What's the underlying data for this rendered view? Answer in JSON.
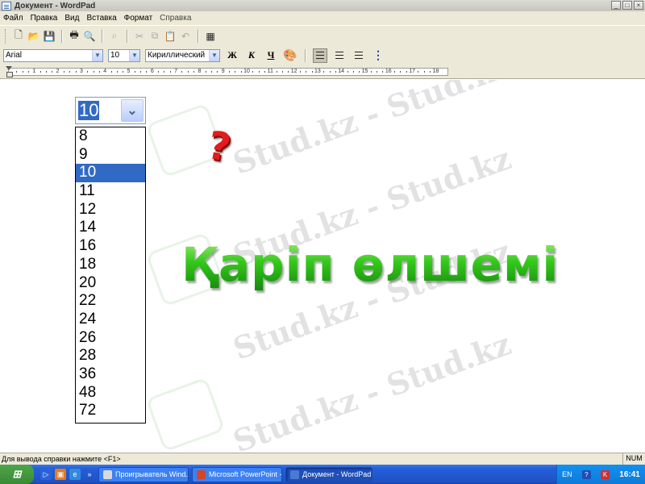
{
  "window": {
    "title": "Документ - WordPad",
    "min": "_",
    "max": "□",
    "close": "×"
  },
  "menu": [
    "Файл",
    "Правка",
    "Вид",
    "Вставка",
    "Формат",
    "Справка"
  ],
  "format": {
    "font": "Arial",
    "size": "10",
    "script": "Кириллический",
    "bold": "Ж",
    "italic": "К",
    "underline": "Ч"
  },
  "ruler_numbers": [
    "1",
    "2",
    "3",
    "4",
    "5",
    "6",
    "7",
    "8",
    "9",
    "10",
    "11",
    "12",
    "13",
    "14",
    "15",
    "16",
    "17",
    "18"
  ],
  "document": {
    "size_dropdown": {
      "value": "10",
      "options": [
        "8",
        "9",
        "10",
        "11",
        "12",
        "14",
        "16",
        "18",
        "20",
        "22",
        "24",
        "26",
        "28",
        "36",
        "48",
        "72"
      ],
      "selected": "10"
    },
    "question_mark": "?",
    "headline": "Қаріп өлшемі",
    "watermark": "Stud.kz - Stud.kz"
  },
  "status": {
    "text": "Для вывода справки нажмите <F1>",
    "num": "NUM"
  },
  "taskbar": {
    "tasks": [
      {
        "label": "Проигрыватель Wind...",
        "active": false
      },
      {
        "label": "Microsoft PowerPoint -...",
        "active": false
      },
      {
        "label": "Документ - WordPad",
        "active": true
      }
    ],
    "lang": "EN",
    "clock": "16:41"
  },
  "colors": {
    "headline": "#2bbd18",
    "question": "#e21c1c",
    "selection": "#316ac5",
    "taskbar": "#245edb"
  }
}
